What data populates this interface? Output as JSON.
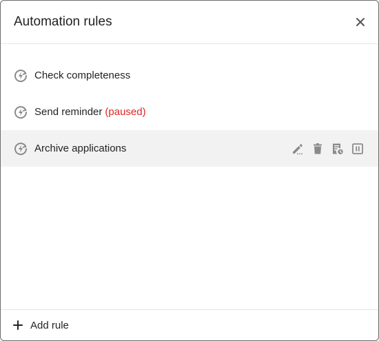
{
  "dialog": {
    "title": "Automation rules"
  },
  "rules": [
    {
      "label": "Check completeness",
      "status": ""
    },
    {
      "label": "Send reminder",
      "status": "(paused)"
    },
    {
      "label": "Archive applications",
      "status": ""
    }
  ],
  "row_actions": [
    "edit-icon",
    "delete-icon",
    "history-icon",
    "pause-icon"
  ],
  "footer": {
    "add_label": "Add rule"
  },
  "colors": {
    "paused_text": "#e02424",
    "icon_gray": "#8a8a8a",
    "hover_row_bg": "#f2f2f2"
  }
}
